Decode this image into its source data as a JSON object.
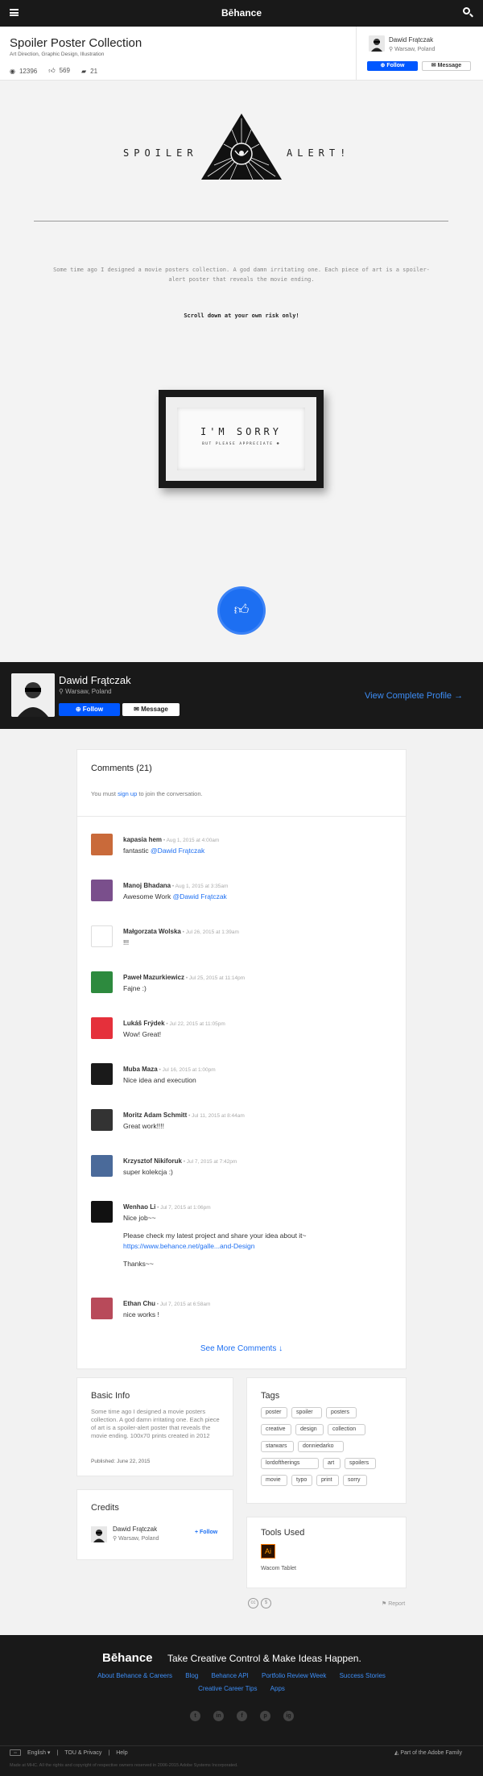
{
  "topbar": {
    "logo": "Bēhance"
  },
  "project": {
    "title": "Spoiler Poster Collection",
    "fields": "Art Direction, Graphic Design, Illustration",
    "views": "12396",
    "appreciations": "569",
    "comments": "21"
  },
  "owner": {
    "name": "Dawid Frątczak",
    "location": "Warsaw, Poland",
    "follow_label": "Follow",
    "message_label": "Message",
    "view_profile_label": "View Complete Profile →"
  },
  "artwork": {
    "spoiler_left": "SPOILER",
    "spoiler_right": "ALERT!",
    "description": "Some time ago I designed a movie posters collection. A god damn irritating one. Each piece of art is a spoiler-alert poster that reveals the movie ending.",
    "warning": "Scroll down at your own risk only!",
    "frame_title": "I'M SORRY",
    "frame_subtitle": "BUT PLEASE APPRECIATE ☻"
  },
  "comments": {
    "title": "Comments (21)",
    "note_prefix": "You must",
    "note_link": "sign up",
    "note_suffix": "to join the conversation.",
    "see_more": "See More Comments ↓",
    "items": [
      {
        "name": "kapasia hem",
        "date": "Aug 1, 2015 at 4:00am",
        "text": "fantastic",
        "mention": "@Dawid Frątczak",
        "color": "#c96a3a"
      },
      {
        "name": "Manoj Bhadana",
        "date": "Aug 1, 2015 at 3:35am",
        "text": "Awesome Work",
        "mention": "@Dawid Frątczak",
        "color": "#7a4f8c"
      },
      {
        "name": "Małgorzata Wolska",
        "date": "Jul 26, 2015 at 1:39am",
        "text": "!!!",
        "mention": "",
        "color": "#ffffff"
      },
      {
        "name": "Paweł Mazurkiewicz",
        "date": "Jul 25, 2015 at 11:14pm",
        "text": "Fajne :)",
        "mention": "",
        "color": "#2d8a3e"
      },
      {
        "name": "Lukáš Frýdek",
        "date": "Jul 22, 2015 at 11:05pm",
        "text": "Wow! Great!",
        "mention": "",
        "color": "#e5303b"
      },
      {
        "name": "Muba Maza",
        "date": "Jul 16, 2015 at 1:00pm",
        "text": "Nice idea and execution",
        "mention": "",
        "color": "#1a1a1a"
      },
      {
        "name": "Moritz Adam Schmitt",
        "date": "Jul 11, 2015 at 8:44am",
        "text": "Great work!!!!",
        "mention": "",
        "color": "#333333"
      },
      {
        "name": "Krzysztof Nikiforuk",
        "date": "Jul 7, 2015 at 7:42pm",
        "text": "super kolekcja :)",
        "mention": "",
        "color": "#4a6a9a"
      },
      {
        "name": "Wenhao Li",
        "date": "Jul 7, 2015 at 1:06pm",
        "text": "Nice job~~",
        "extra1": "Please check my latest project and share your idea about it~",
        "link": "https://www.behance.net/galle...and-Design",
        "extra2": "Thanks~~",
        "color": "#111111"
      },
      {
        "name": "Ethan Chu",
        "date": "Jul 7, 2015 at 6:58am",
        "text": "nice works !",
        "mention": "",
        "color": "#b84a5a"
      }
    ]
  },
  "basic_info": {
    "title": "Basic Info",
    "description": "Some time ago I designed a movie posters collection. A god damn irritating one. Each piece of art is a spoiler-alert poster that reveals the movie ending. 100x70 prints created in 2012",
    "published": "Published: June 22, 2015"
  },
  "credits": {
    "title": "Credits",
    "name": "Dawid Frątczak",
    "location": "Warsaw, Poland",
    "follow_label": "+ Follow"
  },
  "tags": {
    "title": "Tags",
    "items": [
      "poster",
      "spoiler",
      "posters",
      "creative",
      "design",
      "collection",
      "starwars",
      "donniedarko",
      "lordoftherings",
      "art",
      "spoilers",
      "movie",
      "typo",
      "print",
      "sorry"
    ]
  },
  "tools": {
    "title": "Tools Used",
    "icon_letter": "Ai",
    "item": "Wacom Tablet"
  },
  "report_label": "⚑ Report",
  "footer": {
    "logo": "Bēhance",
    "tagline": "Take Creative Control & Make Ideas Happen.",
    "links": [
      "About Behance & Careers",
      "Blog",
      "Behance API",
      "Portfolio Review Week",
      "Success Stories"
    ],
    "links2": [
      "Creative Career Tips",
      "Apps"
    ],
    "social": [
      "t",
      "in",
      "f",
      "p",
      "ig"
    ],
    "language": "English ▾",
    "tou": "TOU & Privacy",
    "help": "Help",
    "adobe": "Part of the Adobe Family",
    "copyright": "Made at MHC. All the rights and copyright of respective owners reserved in 2006-2015 Adobe Systems Incorporated."
  }
}
